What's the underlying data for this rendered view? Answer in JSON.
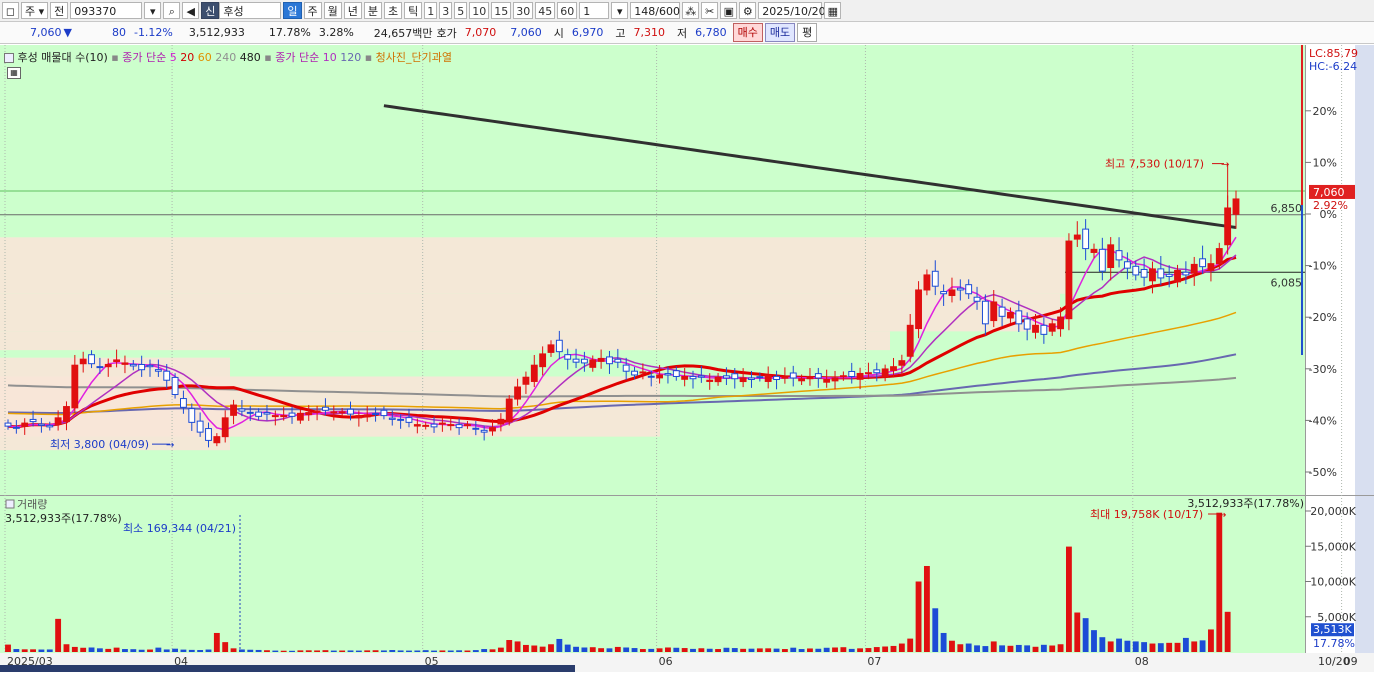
{
  "toolbar": {
    "market_select": "주",
    "prev_label": "전",
    "code_value": "093370",
    "badge": "신",
    "stock_name": "후성",
    "period_day": "일",
    "period_week": "주",
    "period_month": "월",
    "period_year": "년",
    "period_minute": "분",
    "period_second": "초",
    "period_tick": "틱",
    "intervals": [
      "1",
      "3",
      "5",
      "10",
      "15",
      "30",
      "45",
      "60"
    ],
    "interval_value": "1",
    "count": "148/600",
    "date": "2025/10/20"
  },
  "quote": {
    "price": "7,060",
    "change": "80",
    "change_pct": "-1.12%",
    "volume": "3,512,933",
    "turnover_pct": "17.78%",
    "other_pct": "3.28%",
    "amount": "24,657백만",
    "bid_label": "호가",
    "ask": "7,070",
    "bid": "7,060",
    "open_label": "시",
    "open": "6,970",
    "high_label": "고",
    "high": "7,310",
    "low_label": "저",
    "low": "6,780",
    "buy_label": "매수",
    "sell_label": "매도",
    "eval_label": "평"
  },
  "legend": {
    "name": "후성 매물대 수(10)",
    "ma_label": "종가 단순",
    "ma_periods": [
      "5",
      "20",
      "60",
      "240",
      "480"
    ],
    "ma2_label": "종가 단순",
    "ma2_periods": [
      "10",
      "120"
    ],
    "overbought": "청사진_단기과열"
  },
  "colors": {
    "background": "#ccffcc",
    "profile": "#f8e6d8",
    "up": "#e01010",
    "down": "#1c4cd6",
    "ma5": "#e020e0",
    "ma20": "#e00000",
    "ma60": "#e8a000",
    "ma240": "#909090",
    "ma480": "#303030",
    "ma10": "#b030c0",
    "ma120": "#6868b0"
  },
  "axis": {
    "lc": "LC:85.79",
    "hc": "HC:-6.24",
    "ticks": [
      "20%",
      "10%",
      "0%",
      "-10%",
      "-20%",
      "-30%",
      "-40%",
      "-50%"
    ],
    "price_label": "7,060",
    "pct_label": "2.92%",
    "level_6850": "6,850",
    "level_6085": "6,085",
    "vol_ticks": [
      "20,000K",
      "15,000K",
      "10,000K",
      "5,000K"
    ],
    "vol_current": "3,513K",
    "vol_pct": "17.78%",
    "months": [
      "2025/03",
      "04",
      "05",
      "06",
      "07",
      "08",
      "09",
      "10",
      "10/20"
    ]
  },
  "annotations": {
    "high": "최고 7,530 (10/17)",
    "low": "최저 3,800 (04/09)",
    "vol_title": "거래량",
    "vol_value": "3,512,933주(17.78%)",
    "vol_value_right": "3,512,933주(17.78%)",
    "vol_min": "최소 169,344 (04/21)",
    "vol_max": "최대 19,758K (10/17)"
  },
  "chart_data": {
    "type": "candlestick",
    "x_range": [
      "2025/03",
      "2025/10/20"
    ],
    "y_unit": "KRW",
    "last_close": 7060,
    "high": {
      "value": 7530,
      "date": "10/17"
    },
    "low": {
      "value": 3800,
      "date": "04/09"
    },
    "closes": [
      4040,
      4020,
      4080,
      4100,
      4050,
      4030,
      4150,
      4300,
      4850,
      4930,
      4870,
      4830,
      4860,
      4920,
      4880,
      4840,
      4790,
      4830,
      4770,
      4650,
      4460,
      4290,
      4090,
      3960,
      3850,
      3900,
      4150,
      4320,
      4240,
      4210,
      4170,
      4200,
      4180,
      4180,
      4170,
      4210,
      4220,
      4240,
      4250,
      4230,
      4230,
      4200,
      4180,
      4190,
      4200,
      4180,
      4130,
      4120,
      4090,
      4060,
      4050,
      4030,
      4080,
      4060,
      4020,
      4060,
      4000,
      3960,
      4020,
      4130,
      4400,
      4560,
      4690,
      4850,
      5000,
      5120,
      5030,
      4930,
      4890,
      4880,
      4920,
      4940,
      4870,
      4890,
      4770,
      4720,
      4760,
      4700,
      4720,
      4720,
      4700,
      4700,
      4670,
      4690,
      4650,
      4690,
      4680,
      4670,
      4680,
      4660,
      4690,
      4720,
      4660,
      4690,
      4680,
      4670,
      4700,
      4680,
      4660,
      4680,
      4710,
      4700,
      4740,
      4750,
      4750,
      4800,
      4830,
      4910,
      5380,
      5850,
      6050,
      5900,
      5800,
      5850,
      5850,
      5800,
      5700,
      5400,
      5690,
      5500,
      5550,
      5400,
      5330,
      5380,
      5260,
      5400,
      5490,
      6500,
      6580,
      6400,
      6390,
      6100,
      6450,
      6250,
      6140,
      6050,
      6020,
      6130,
      6010,
      6030,
      6110,
      6050,
      6190,
      6160,
      6200,
      6400,
      6940,
      7060
    ],
    "volumes_k": [
      1050,
      420,
      380,
      380,
      350,
      360,
      4700,
      1100,
      720,
      600,
      640,
      520,
      440,
      620,
      420,
      400,
      320,
      350,
      620,
      360,
      470,
      340,
      300,
      280,
      350,
      2700,
      1400,
      520,
      360,
      320,
      290,
      250,
      200,
      180,
      170,
      230,
      240,
      220,
      260,
      200,
      210,
      220,
      200,
      230,
      250,
      220,
      280,
      220,
      200,
      210,
      260,
      200,
      220,
      210,
      240,
      210,
      270,
      420,
      380,
      620,
      1700,
      1500,
      1000,
      920,
      760,
      1100,
      1850,
      1050,
      740,
      640,
      680,
      540,
      520,
      720,
      640,
      560,
      420,
      440,
      520,
      640,
      600,
      560,
      440,
      530,
      460,
      420,
      600,
      560,
      450,
      470,
      510,
      520,
      480,
      420,
      610,
      420,
      500,
      460,
      600,
      640,
      680,
      440,
      520,
      560,
      700,
      780,
      860,
      1200,
      1900,
      10000,
      12200,
      6200,
      2700,
      1600,
      1100,
      1200,
      940,
      840,
      1500,
      940,
      880,
      1000,
      940,
      740,
      1020,
      920,
      1100,
      14950,
      5600,
      4800,
      3100,
      2100,
      1500,
      1900,
      1600,
      1500,
      1400,
      1200,
      1250,
      1300,
      1300,
      2000,
      1500,
      1650,
      3200,
      19758,
      5700
    ],
    "moving_averages": [
      "5",
      "20",
      "60",
      "240",
      "480",
      "10",
      "120"
    ],
    "volume_max_k": 19758,
    "volume_min": {
      "value": 169344,
      "date": "04/21"
    },
    "volume_last_k": 3513
  }
}
